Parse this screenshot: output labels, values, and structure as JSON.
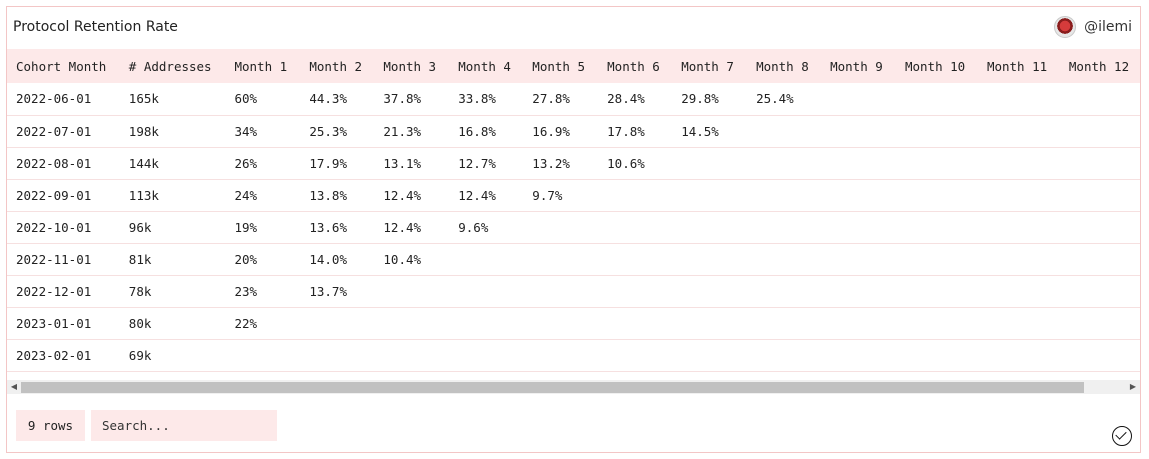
{
  "header": {
    "title": "Protocol Retention Rate",
    "author": "@ilemi"
  },
  "table": {
    "columns": [
      "Cohort Month",
      "# Addresses",
      "Month 1",
      "Month 2",
      "Month 3",
      "Month 4",
      "Month 5",
      "Month 6",
      "Month 7",
      "Month 8",
      "Month 9",
      "Month 10",
      "Month 11",
      "Month 12"
    ],
    "rows": [
      [
        "2022-06-01",
        "165k",
        "60%",
        "44.3%",
        "37.8%",
        "33.8%",
        "27.8%",
        "28.4%",
        "29.8%",
        "25.4%",
        "",
        "",
        "",
        ""
      ],
      [
        "2022-07-01",
        "198k",
        "34%",
        "25.3%",
        "21.3%",
        "16.8%",
        "16.9%",
        "17.8%",
        "14.5%",
        "",
        "",
        "",
        "",
        ""
      ],
      [
        "2022-08-01",
        "144k",
        "26%",
        "17.9%",
        "13.1%",
        "12.7%",
        "13.2%",
        "10.6%",
        "",
        "",
        "",
        "",
        "",
        ""
      ],
      [
        "2022-09-01",
        "113k",
        "24%",
        "13.8%",
        "12.4%",
        "12.4%",
        "9.7%",
        "",
        "",
        "",
        "",
        "",
        "",
        ""
      ],
      [
        "2022-10-01",
        "96k",
        "19%",
        "13.6%",
        "12.4%",
        "9.6%",
        "",
        "",
        "",
        "",
        "",
        "",
        "",
        ""
      ],
      [
        "2022-11-01",
        "81k",
        "20%",
        "14.0%",
        "10.4%",
        "",
        "",
        "",
        "",
        "",
        "",
        "",
        "",
        ""
      ],
      [
        "2022-12-01",
        "78k",
        "23%",
        "13.7%",
        "",
        "",
        "",
        "",
        "",
        "",
        "",
        "",
        "",
        ""
      ],
      [
        "2023-01-01",
        "80k",
        "22%",
        "",
        "",
        "",
        "",
        "",
        "",
        "",
        "",
        "",
        "",
        ""
      ],
      [
        "2023-02-01",
        "69k",
        "",
        "",
        "",
        "",
        "",
        "",
        "",
        "",
        "",
        "",
        "",
        ""
      ]
    ]
  },
  "footer": {
    "rows_label": "9 rows",
    "search_placeholder": "Search..."
  },
  "icons": {
    "avatar": "avatar-image",
    "scroll_left": "triangle-left-icon",
    "scroll_right": "triangle-right-icon",
    "status": "check-circle-icon"
  }
}
